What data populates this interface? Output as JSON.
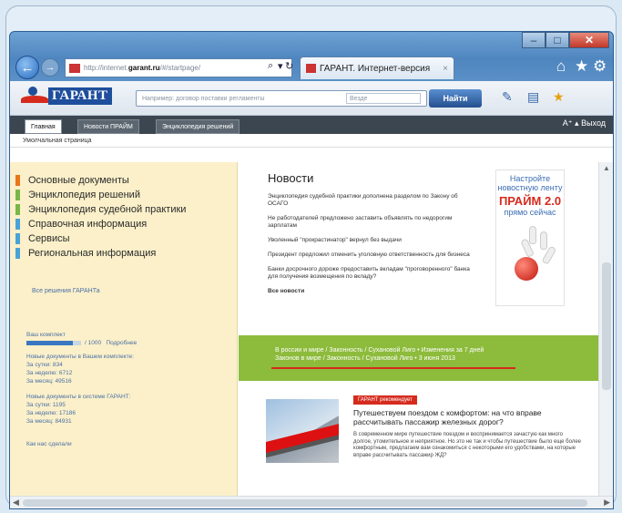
{
  "browser": {
    "window_controls": {
      "minimize": "–",
      "maximize": "□",
      "close": "✕"
    },
    "nav": {
      "back_icon": "back-arrow-icon",
      "forward_icon": "forward-arrow-icon"
    },
    "address": {
      "prefix": "http://internet.",
      "host": "garant.ru",
      "suffix": "/#/startpage/",
      "search_icon": "⌕",
      "dropdown_icon": "▾",
      "refresh_icon": "↻"
    },
    "tab": {
      "title": "ГАРАНТ. Интернет-версия",
      "close": "×"
    },
    "toolbar_icons": {
      "home": "⌂",
      "favorites": "★",
      "settings": "⚙"
    }
  },
  "garant": {
    "logo_text": "ГАРАНТ",
    "search_placeholder": "Например: договор поставки регламенты",
    "search_scope": "Везде",
    "find_button": "Найти",
    "tabs": [
      "Главная",
      "Новости ПРАЙМ",
      "Энциклопедия решений"
    ],
    "tabs_right": "A⁺ ▴  Выход",
    "breadcrumb": "Умолчальная страница"
  },
  "menu": {
    "items": [
      {
        "label": "Основные документы",
        "color": "#e8761a"
      },
      {
        "label": "Энциклопедия решений",
        "color": "#7ab648"
      },
      {
        "label": "Энциклопедия судебной практики",
        "color": "#7ab648"
      },
      {
        "label": "Справочная информация",
        "color": "#4aa3d8"
      },
      {
        "label": "Сервисы",
        "color": "#4aa3d8"
      },
      {
        "label": "Региональная информация",
        "color": "#4aa3d8"
      }
    ],
    "link": "Все решения ГАРАНТа",
    "limit_label": "Ваш комплект",
    "limit_value": "/ 1000",
    "limit_fill": 0.85,
    "limit_details": "Подробнее",
    "new_docs_block": [
      "Новые документы в Вашем комплекте:",
      "За сутки: 834",
      "За неделю: 6712",
      "За месяц: 49516"
    ],
    "new_docs_block2": [
      "Новые документы в системе ГАРАНТ:",
      "За сутки: 1195",
      "За неделю: 17186",
      "За месяц: 84931"
    ],
    "bottom_link": "Как нас сделали"
  },
  "news": {
    "title": "Новости",
    "items": [
      "Энциклопедия судебной практики дополнена разделом по Закону об ОСАГО",
      "Не работодателей предложено заставить объявлять по недорогим зарплатам",
      "Уволенный \"прокрастинатор\" вернул без выдачи",
      "Президент предложил отменить уголовную ответственность для бизнеса",
      "Банки досрочного дороже предоставить вкладам \"проговоренного\" банка для получения возмещения по вкладу?"
    ],
    "all_link": "Все новости"
  },
  "promo": {
    "line1": "Настройте новостную ленту",
    "line2": "ПРАЙМ 2.0",
    "line3": "прямо сейчас"
  },
  "green_bar": {
    "line1": "В россии и мире / Законность / Сухановой Лиго • Изменения за 7 дней",
    "line2": "Законов в мире / Законность / Сухановой Лиго • 3 июня 2013"
  },
  "feature": {
    "badge": "ГАРАНТ рекомендует",
    "title": "Путешествуем поездом с комфортом: на что вправе рассчитывать пассажир железных дорог?",
    "text": "В современном мире путешествие поездом и воспринимается зачастую как много долгое, утомительное и неприятное. Но это не так и чтобы путешествие было еще более комфортным, предлагаем вам ознакомиться с некоторыми его удобствами, на которые вправе рассчитывать пассажир ЖД?"
  }
}
